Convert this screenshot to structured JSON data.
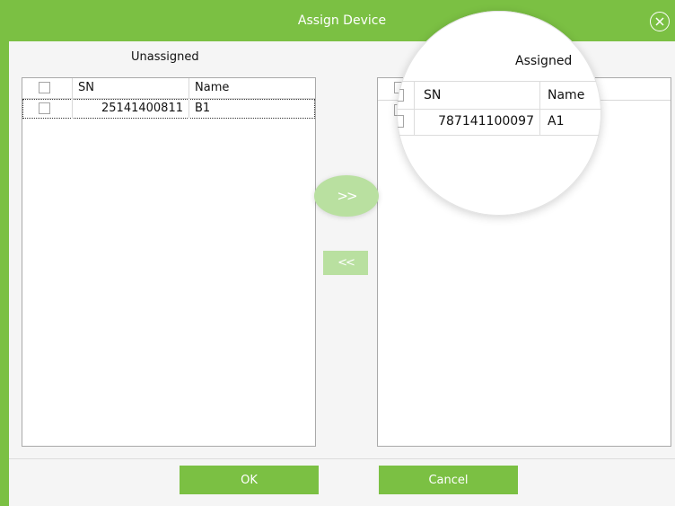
{
  "dialog": {
    "title": "Assign Device",
    "close_icon": "close-circle-icon"
  },
  "unassigned": {
    "title": "Unassigned",
    "columns": {
      "sn": "SN",
      "name": "Name"
    },
    "rows": [
      {
        "sn": "25141400811",
        "name": "B1",
        "checked": false,
        "selected": true
      }
    ]
  },
  "assigned": {
    "title": "Assigned",
    "columns": {
      "sn": "SN",
      "name": "Name"
    },
    "rows": [
      {
        "sn": "787141100097",
        "name": "A1",
        "checked": false,
        "selected": false
      }
    ]
  },
  "transfer": {
    "assign_label": ">>",
    "unassign_label": "<<"
  },
  "footer": {
    "ok_label": "OK",
    "cancel_label": "Cancel"
  },
  "colors": {
    "accent": "#7bc043",
    "button_light": "#b9e0a0"
  }
}
